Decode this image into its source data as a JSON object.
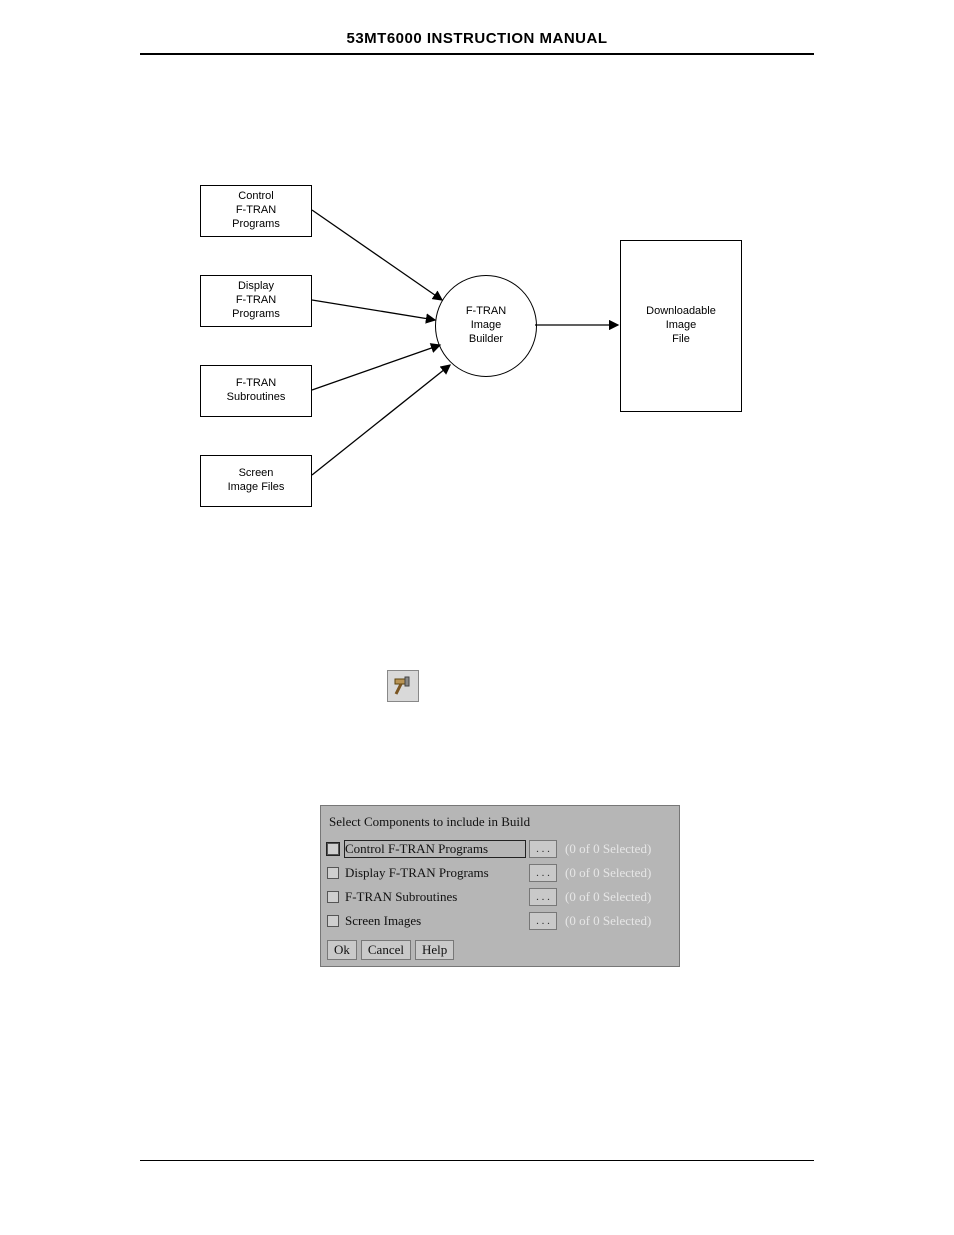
{
  "header": {
    "title": "53MT6000 INSTRUCTION MANUAL"
  },
  "figure": {
    "inputs": [
      "Control\nF-TRAN\nPrograms",
      "Display\nF-TRAN\nPrograms",
      "F-TRAN\nSubroutines",
      "Screen\nImage Files"
    ],
    "center": "F-TRAN\nImage\nBuilder",
    "output": "Downloadable\nImage\nFile"
  },
  "icon": {
    "name": "hammer-icon"
  },
  "dialog": {
    "prompt": "Select Components to include in Build",
    "rows": [
      {
        "label": "Control F-TRAN Programs",
        "selected_text": "(0 of 0 Selected)",
        "highlight": true
      },
      {
        "label": "Display F-TRAN Programs",
        "selected_text": "(0 of 0 Selected)",
        "highlight": false
      },
      {
        "label": "F-TRAN Subroutines",
        "selected_text": "(0 of 0 Selected)",
        "highlight": false
      },
      {
        "label": "Screen Images",
        "selected_text": "(0 of 0 Selected)",
        "highlight": false
      }
    ],
    "dots": ". . .",
    "buttons": {
      "ok": "Ok",
      "cancel": "Cancel",
      "help": "Help"
    }
  }
}
